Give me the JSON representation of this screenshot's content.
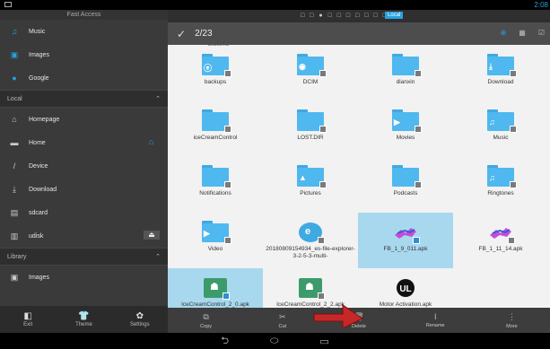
{
  "status": {
    "time": "2:08",
    "tabs_label": "Local"
  },
  "sidebar": {
    "header": "Fast Access",
    "top_items": [
      {
        "label": "Music",
        "icon": "music-icon"
      },
      {
        "label": "Images",
        "icon": "image-icon"
      },
      {
        "label": "Google",
        "icon": "google-icon"
      }
    ],
    "local_section": "Local",
    "local_items": [
      {
        "label": "Homepage",
        "icon": "homepage-icon"
      },
      {
        "label": "Home",
        "icon": "home-folder-icon"
      },
      {
        "label": "Device",
        "icon": "slash-icon"
      },
      {
        "label": "Download",
        "icon": "download-icon"
      },
      {
        "label": "sdcard",
        "icon": "sdcard-icon"
      },
      {
        "label": "udisk",
        "icon": "udisk-icon"
      }
    ],
    "library_section": "Library",
    "library_items": [
      {
        "label": "Images",
        "icon": "image-icon"
      }
    ],
    "bottom": [
      {
        "label": "Exit",
        "icon": "exit-icon"
      },
      {
        "label": "Theme",
        "icon": "theme-icon"
      },
      {
        "label": "Settings",
        "icon": "settings-icon"
      }
    ]
  },
  "toolbar": {
    "count": "2/23"
  },
  "files": {
    "partial_top": "bitcoinra",
    "items": [
      {
        "name": "backups",
        "kind": "folder",
        "sym": "e"
      },
      {
        "name": "DCIM",
        "kind": "folder",
        "sym": "cam"
      },
      {
        "name": "dianxin",
        "kind": "folder",
        "sym": ""
      },
      {
        "name": "Download",
        "kind": "folder",
        "sym": "dl"
      },
      {
        "name": "iceCreamControl",
        "kind": "folder",
        "sym": ""
      },
      {
        "name": "LOST.DIR",
        "kind": "folder",
        "sym": ""
      },
      {
        "name": "Movies",
        "kind": "folder",
        "sym": "play"
      },
      {
        "name": "Music",
        "kind": "folder",
        "sym": "note"
      },
      {
        "name": "Notifications",
        "kind": "folder",
        "sym": ""
      },
      {
        "name": "Pictures",
        "kind": "folder",
        "sym": "pic"
      },
      {
        "name": "Podcasts",
        "kind": "folder",
        "sym": ""
      },
      {
        "name": "Ringtones",
        "kind": "folder",
        "sym": "note"
      },
      {
        "name": "Video",
        "kind": "folder",
        "sym": "play"
      },
      {
        "name": "20180809154934_es-file-explorer-3-2-5-3-multi-",
        "kind": "es",
        "sym": ""
      },
      {
        "name": "FB_1_9_011.apk",
        "kind": "fb",
        "sym": "",
        "selected": true
      },
      {
        "name": "FB_1_11_14.apk",
        "kind": "fb",
        "sym": ""
      },
      {
        "name": "IceCreamControl_2_0.apk",
        "kind": "android",
        "sym": "",
        "selected": true
      },
      {
        "name": "IceCreamControl_2_2.apk",
        "kind": "android",
        "sym": ""
      },
      {
        "name": "Motor Activation.apk",
        "kind": "ul",
        "sym": ""
      }
    ]
  },
  "actions": [
    {
      "label": "Copy",
      "icon": "copy-icon"
    },
    {
      "label": "Cut",
      "icon": "cut-icon"
    },
    {
      "label": "Delete",
      "icon": "delete-icon"
    },
    {
      "label": "Rename",
      "icon": "rename-icon"
    },
    {
      "label": "More",
      "icon": "more-icon"
    }
  ],
  "colors": {
    "accent": "#29a0e0",
    "selected_bg": "#a8d8ee",
    "folder": "#4fb8ee",
    "arrow": "#c62828"
  }
}
